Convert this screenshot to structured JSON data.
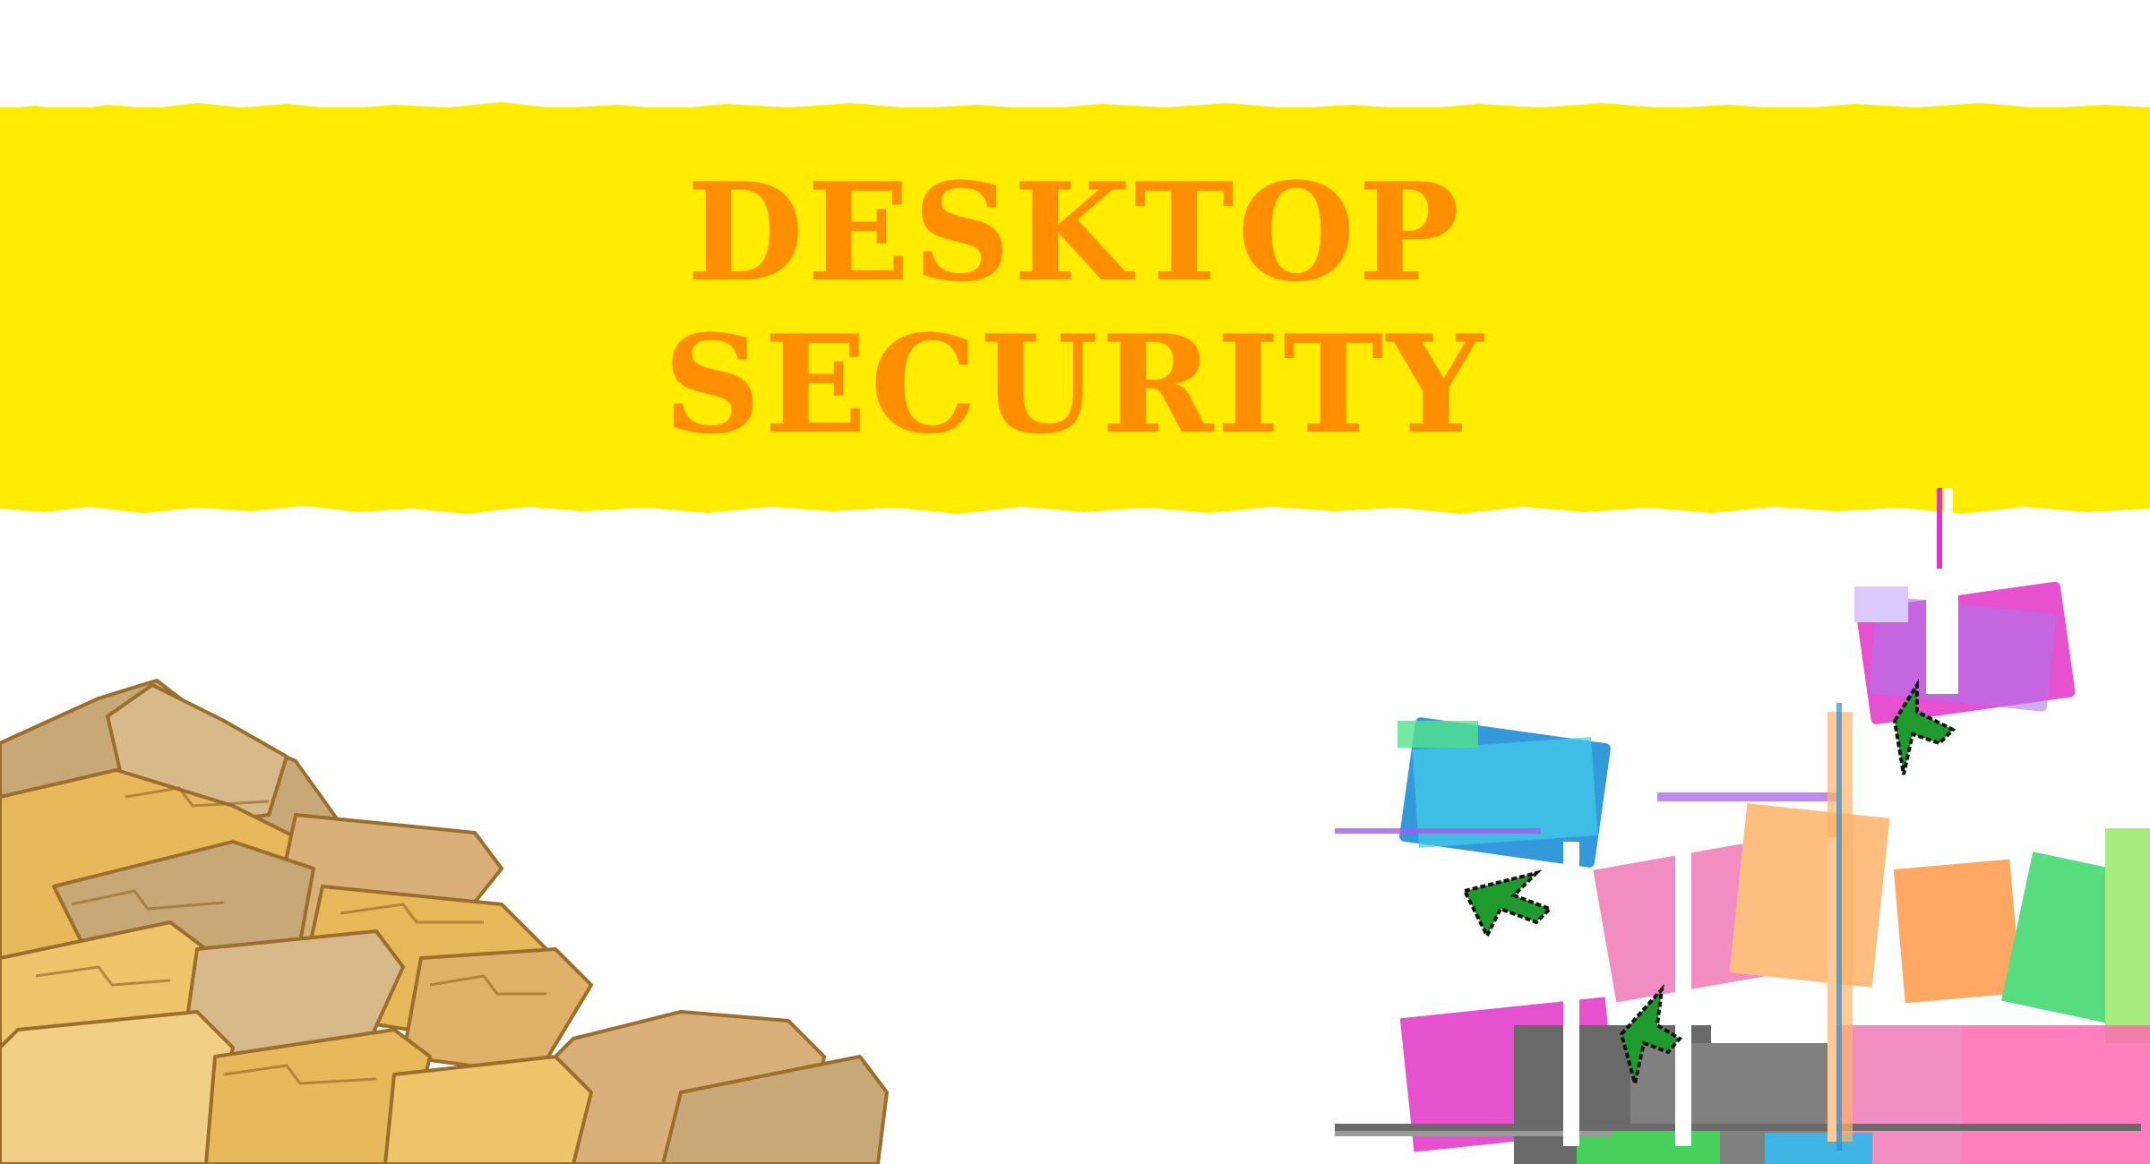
{
  "banner": {
    "title_line1": "DESKTOP",
    "title_line2": "SECURITY"
  },
  "colors": {
    "banner": "#ffec00",
    "title": "#ff8f00",
    "folder": "#e8b95a",
    "folder_shadow": "#b7935a",
    "glitch_magenta": "#e233c8",
    "glitch_cyan": "#2fc6e8",
    "glitch_green": "#28c840"
  },
  "illustrations": {
    "left": "folder-pile-icon",
    "right": "glitched-folders-cursors-icon"
  }
}
